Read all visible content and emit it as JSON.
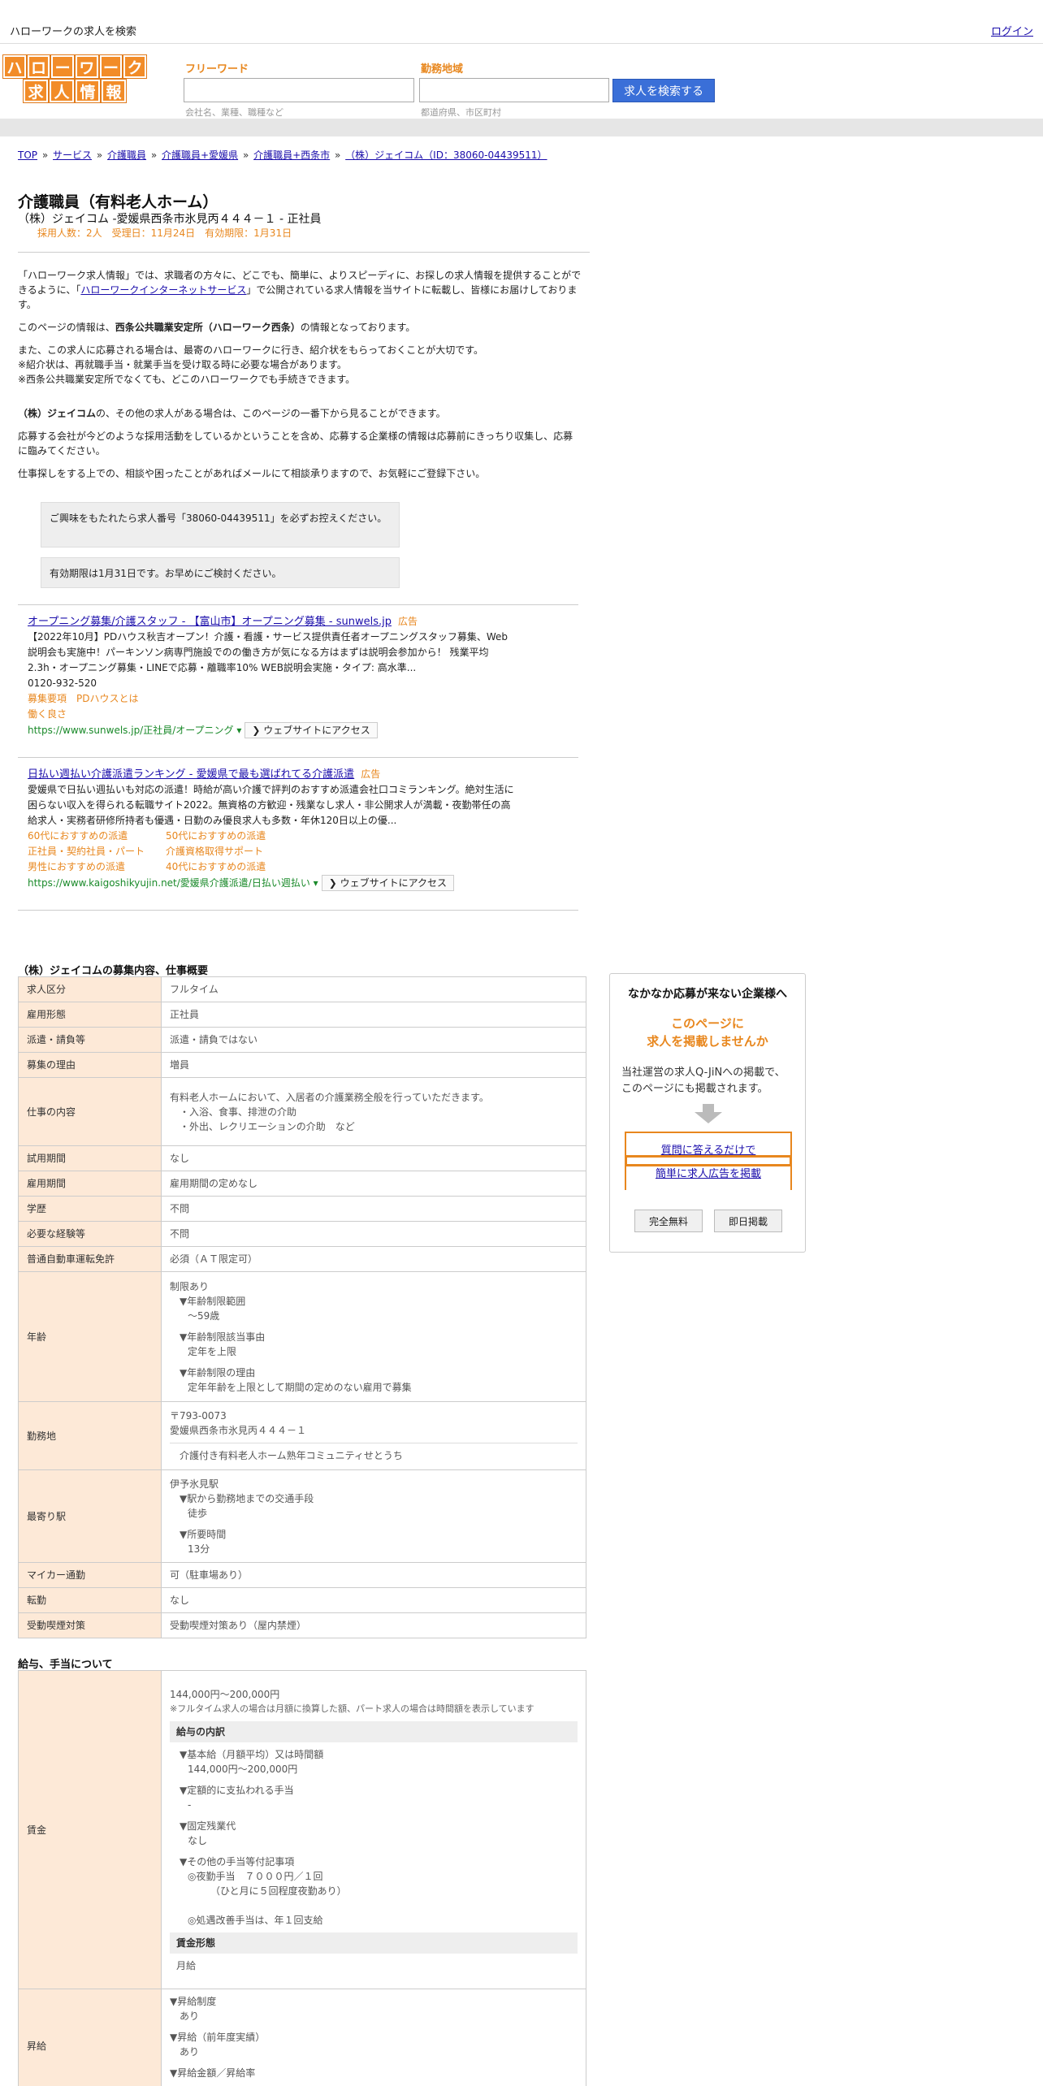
{
  "topbar": {
    "site_title": "ハローワークの求人を検索",
    "login": "ログイン"
  },
  "logo": {
    "row1": [
      "ハ",
      "ロ",
      "ー",
      "ワ",
      "ー",
      "ク"
    ],
    "row2": [
      "求",
      "人",
      "情",
      "報"
    ]
  },
  "search": {
    "keyword_label": "フリーワード",
    "keyword_hint": "会社名、業種、職種など",
    "area_label": "勤務地域",
    "area_hint": "都道府県、市区町村",
    "button": "求人を検索する"
  },
  "breadcrumb": {
    "items": [
      "TOP",
      "サービス",
      "介護職員",
      "介護職員+愛媛県",
      "介護職員+西条市",
      "（株）ジェイコム（ID：38060-04439511）"
    ],
    "sep": "»"
  },
  "job": {
    "title": "介護職員（有料老人ホーム）",
    "subtitle": "（株）ジェイコム -愛媛県西条市氷見丙４４４－１ - 正社員",
    "meta": "採用人数：2人　受理日：11月24日　有効期限：1月31日"
  },
  "intro": {
    "p1_a": "「ハローワーク求人情報」では、求職者の方々に、どこでも、簡単に、よりスピーディに、お探しの求人情報を提供することができるように、「",
    "p1_link": "ハローワークインターネットサービス",
    "p1_b": "」で公開されている求人情報を当サイトに転載し、皆様にお届けしております。",
    "p2_a": "このページの情報は、",
    "p2_bold": "西条公共職業安定所（ハローワーク西条）",
    "p2_b": "の情報となっております。",
    "p3": "また、この求人に応募される場合は、最寄のハローワークに行き、紹介状をもらっておくことが大切です。",
    "p3b": "※紹介状は、再就職手当・就業手当を受け取る時に必要な場合があります。",
    "p3c": "※西条公共職業安定所でなくても、どこのハローワークでも手続きできます。",
    "p4_bold": "（株）ジェイコム",
    "p4": "の、その他の求人がある場合は、このページの一番下から見ることができます。",
    "p5": "応募する会社が今どのような採用活動をしているかということを含め、応募する企業様の情報は応募前にきっちり収集し、応募に臨みてください。",
    "p6": "仕事探しをする上での、相談や困ったことがあればメールにて相談承りますので、お気軽にご登録下さい。"
  },
  "notices": {
    "n1": "ご興味をもたれたら求人番号「38060-04439511」を必ずお控えください。",
    "n2": "有効期限は1月31日です。お早めにご検討ください。"
  },
  "ads": [
    {
      "title": "オープニング募集/介護スタッフ - 【富山市】オープニング募集 - sunwels.jp",
      "badge": "広告",
      "desc": "【2022年10月】PDハウス秋吉オープン！介護・看護・サービス提供責任者オープニングスタッフ募集、Web説明会も実施中！パーキンソン病専門施設でのの働き方が気になる方はまずは説明会参加から！ 残業平均2.3h・オープニング募集・LINEで応募・離職率10% WEB説明会実施・タイプ: 高水準...",
      "phone": "0120-932-520",
      "links": [
        "募集要項",
        "PDハウスとは",
        "働く良さ"
      ],
      "url": "https://www.sunwels.jp/正社員/オープニング",
      "visit": "ウェブサイトにアクセス"
    },
    {
      "title": "日払い週払い介護派遣ランキング - 愛媛県で最も選ばれてる介護派遣",
      "badge": "広告",
      "desc": "愛媛県で日払い週払いも対応の派遣！時給が高い介護で評判のおすすめ派遣会社口コミランキング。絶対生活に困らない収入を得られる転職サイト2022。無資格の方歓迎・残業なし求人・非公開求人が満載・夜勤帯任の高給求人・実務者研修所持者も優遇・日勤のみ優良求人も多数・年休120日以上の優...",
      "links": [
        "60代におすすめの派遣",
        "50代におすすめの派遣",
        "正社員・契約社員・パート",
        "介護資格取得サポート",
        "男性におすすめの派遣",
        "40代におすすめの派遣"
      ],
      "url": "https://www.kaigoshikyujin.net/愛媛県介護派遣/日払い週払い",
      "visit": "ウェブサイトにアクセス"
    }
  ],
  "section1": {
    "title": "（株）ジェイコムの募集内容、仕事概要",
    "rows": {
      "kubun": {
        "k": "求人区分",
        "v": "フルタイム"
      },
      "keitai": {
        "k": "雇用形態",
        "v": "正社員"
      },
      "haken": {
        "k": "派遣・請負等",
        "v": "派遣・請負ではない"
      },
      "riyu": {
        "k": "募集の理由",
        "v": "増員"
      },
      "naiyo": {
        "k": "仕事の内容",
        "v1": "有料老人ホームにおいて、入居者の介護業務全般を行っていただきます。",
        "v2": "・入浴、食事、排泄の介助",
        "v3": "・外出、レクリエーションの介助　など"
      },
      "shiyo": {
        "k": "試用期間",
        "v": "なし"
      },
      "kikan": {
        "k": "雇用期間",
        "v": "雇用期間の定めなし"
      },
      "gakureki": {
        "k": "学歴",
        "v": "不問"
      },
      "keiken": {
        "k": "必要な経験等",
        "v": "不問"
      },
      "menkyo": {
        "k": "普通自動車運転免許",
        "v": "必須（ＡＴ限定可）"
      },
      "nenrei": {
        "k": "年齢",
        "v1": "制限あり",
        "h1": "▼年齢制限範囲",
        "v2": "〜59歳",
        "h2": "▼年齢制限該当事由",
        "v3": "定年を上限",
        "h3": "▼年齢制限の理由",
        "v4": "定年年齢を上限として期間の定めのない雇用で募集"
      },
      "kinmuchi": {
        "k": "勤務地",
        "v1": "〒793-0073",
        "v2": "愛媛県西条市氷見丙４４４－１",
        "v3": "介護付き有料老人ホーム熟年コミュニティせとうち"
      },
      "eki": {
        "k": "最寄り駅",
        "v1": "伊予氷見駅",
        "h1": "▼駅から勤務地までの交通手段",
        "v2": "徒歩",
        "h2": "▼所要時間",
        "v3": "13分"
      },
      "mycar": {
        "k": "マイカー通勤",
        "v": "可（駐車場あり）"
      },
      "tenkin": {
        "k": "転勤",
        "v": "なし"
      },
      "kitsuen": {
        "k": "受動喫煙対策",
        "v": "受動喫煙対策あり（屋内禁煙）"
      }
    }
  },
  "section2": {
    "title": "給与、手当について",
    "chingin": {
      "k": "賃金",
      "range": "144,000円〜200,000円",
      "note": "※フルタイム求人の場合は月額に換算した額、パート求人の場合は時間額を表示しています",
      "head1": "給与の内訳",
      "h_kihon": "▼基本給（月額平均）又は時間額",
      "v_kihon": "144,000円〜200,000円",
      "h_teigaku": "▼定額的に支払われる手当",
      "v_teigaku": "-",
      "h_zangyo": "▼固定残業代",
      "v_zangyo": "なし",
      "h_sonota": "▼その他の手当等付記事項",
      "v_sonota1": "◎夜勤手当　７０００円／１回",
      "v_sonota2": "（ひと月に５回程度夜勤あり）",
      "v_sonota3": "◎処遇改善手当は、年１回支給",
      "head2": "賃金形態",
      "v_keitai": "月給"
    },
    "shokyu": {
      "k": "昇給",
      "h1": "▼昇給制度",
      "v1": "あり",
      "h2": "▼昇給（前年度実績）",
      "v2": "あり",
      "h3": "▼昇給金額／昇給率"
    }
  },
  "sidebar": {
    "title": "なかなか応募が来ない企業様へ",
    "accent1": "このページに",
    "accent2": "求人を掲載しませんか",
    "text": "当社運営の求人Q-JiNへの掲載で、このページにも掲載されます。",
    "link1": "質問に答えるだけで",
    "link2": "簡単に求人広告を掲載",
    "btn1": "完全無料",
    "btn2": "即日掲載"
  }
}
